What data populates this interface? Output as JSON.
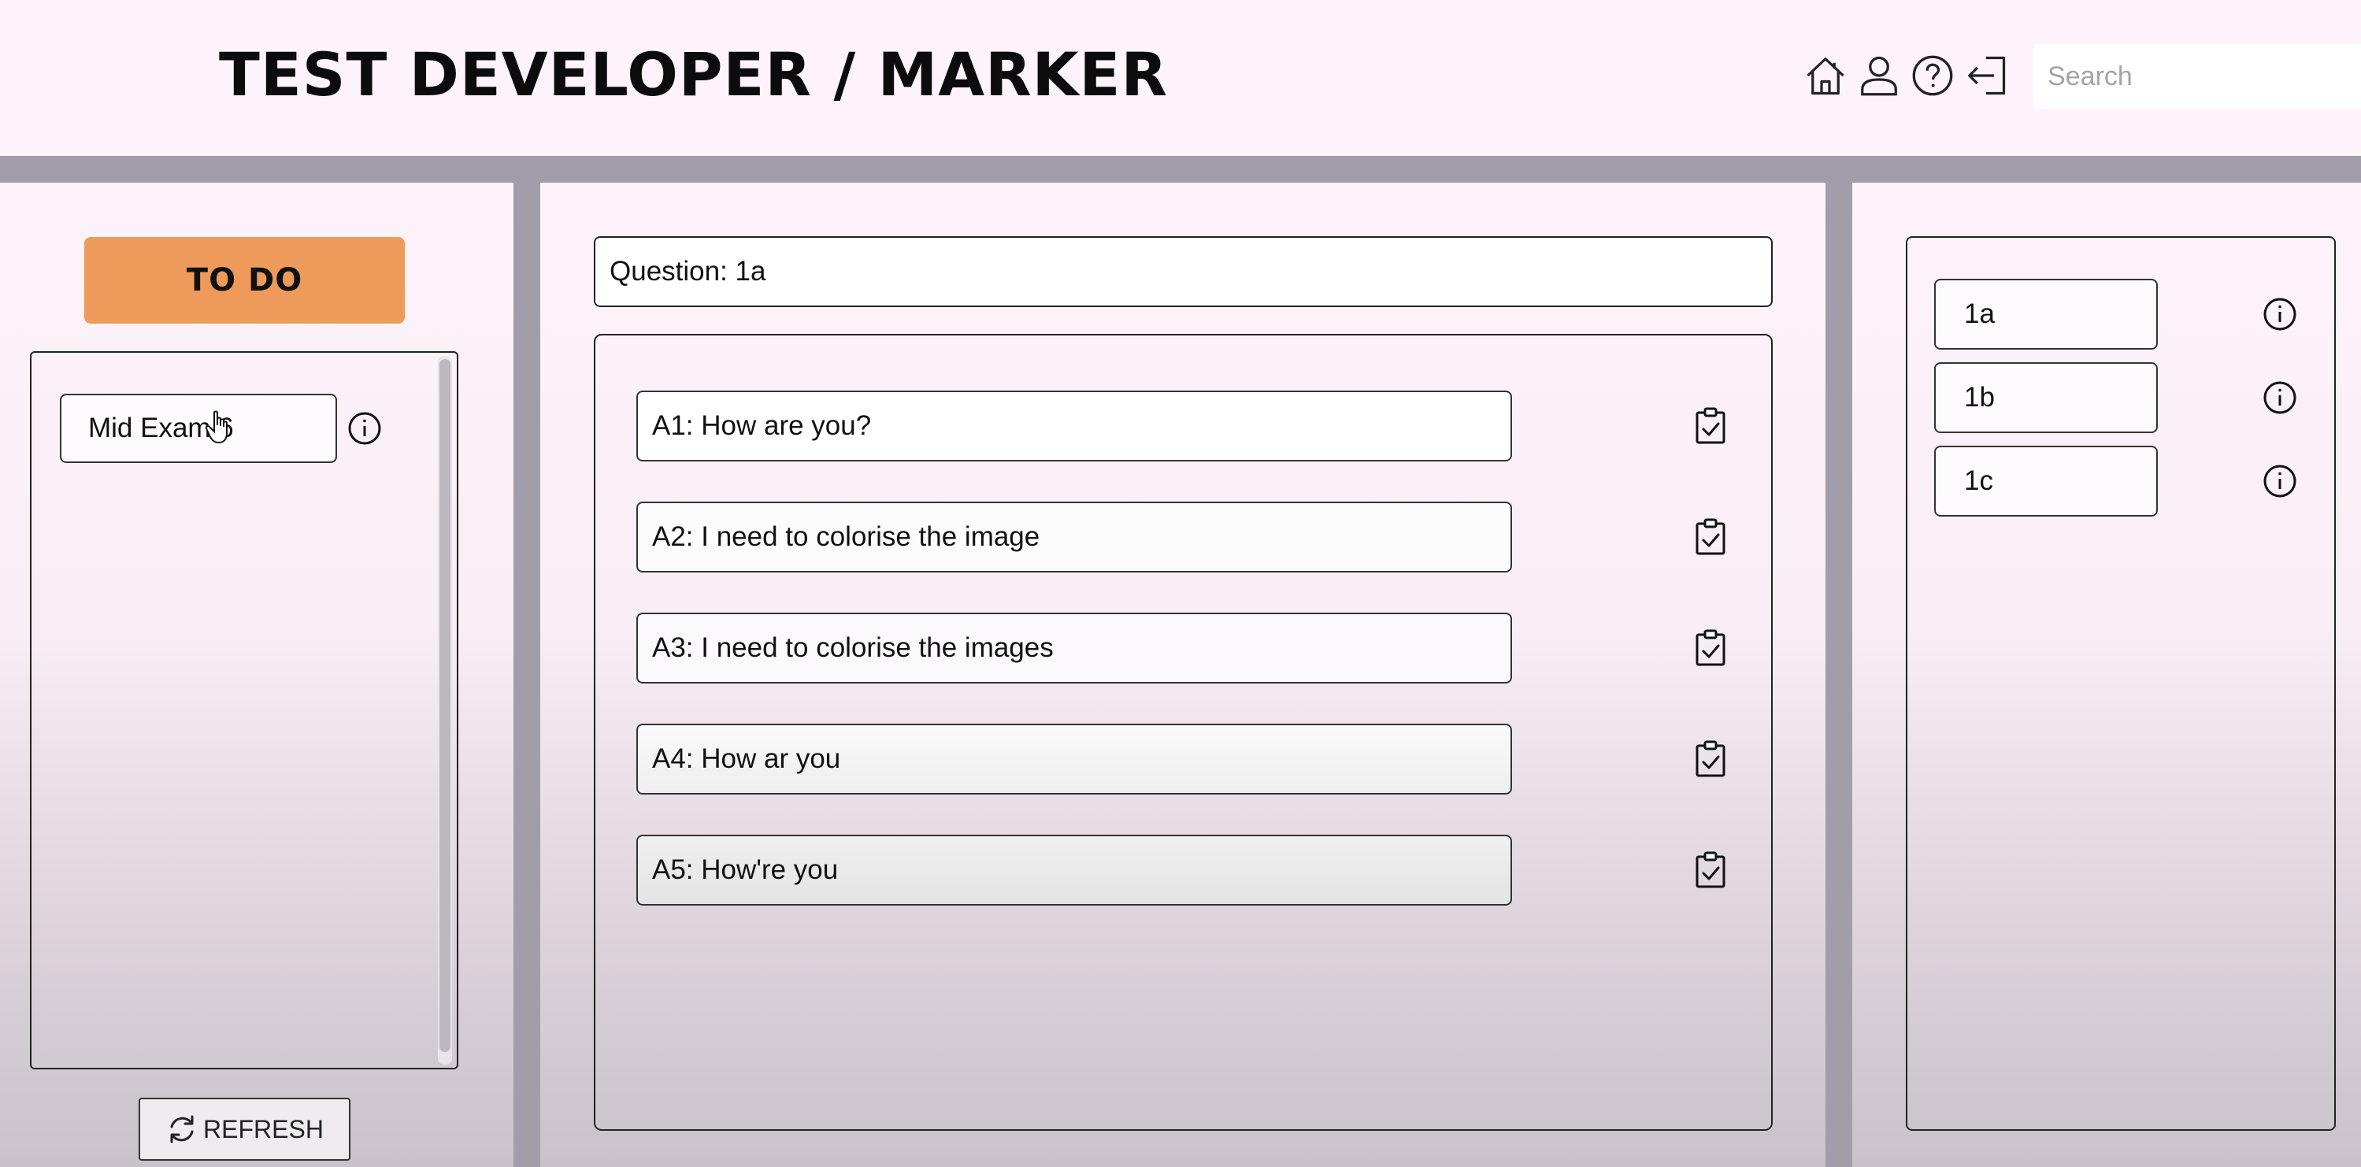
{
  "header": {
    "title": "TEST DEVELOPER / MARKER",
    "icons": [
      "home-icon",
      "user-icon",
      "help-icon",
      "logout-icon"
    ],
    "search": {
      "placeholder": "Search",
      "value": ""
    }
  },
  "left_panel": {
    "todo_label": "TO DO",
    "exams": [
      {
        "label": "Mid Exam 6"
      }
    ],
    "refresh_label": "REFRESH"
  },
  "main": {
    "question_label": "Question: 1a",
    "answers": [
      {
        "label": "A1: How are you?"
      },
      {
        "label": "A2: I need to colorise the image"
      },
      {
        "label": "A3: I need to colorise the images"
      },
      {
        "label": "A4: How ar you"
      },
      {
        "label": "A5: How're you"
      }
    ]
  },
  "right_panel": {
    "questions": [
      {
        "label": "1a"
      },
      {
        "label": "1b"
      },
      {
        "label": "1c"
      }
    ]
  },
  "colors": {
    "header_bg": "#fdf3fa",
    "divider": "#a39dab",
    "todo_accent": "#ee9a5b"
  }
}
